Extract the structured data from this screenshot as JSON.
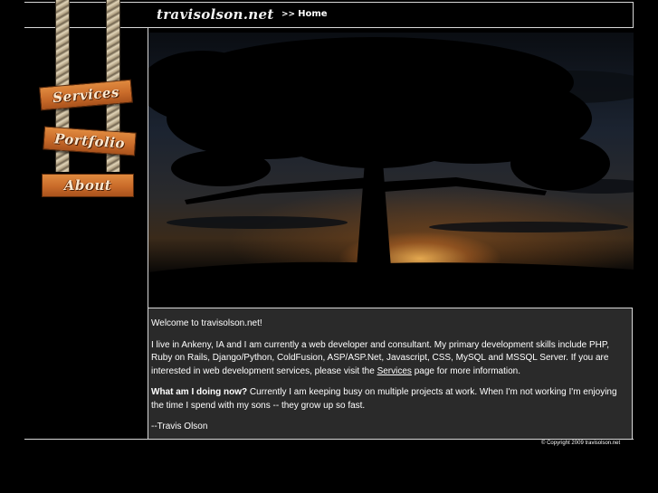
{
  "header": {
    "logo": "travisolson.net",
    "breadcrumb_sep": ">>",
    "breadcrumb_current": "Home"
  },
  "nav": {
    "items": [
      {
        "label": "Services"
      },
      {
        "label": "Portfolio"
      },
      {
        "label": "About"
      }
    ]
  },
  "content": {
    "welcome": "Welcome to travisolson.net!",
    "intro_before_link": "I live in Ankeny, IA and I am currently a web developer and consultant. My primary development skills include PHP, Ruby on Rails, Django/Python, ColdFusion, ASP/ASP.Net, Javascript, CSS, MySQL and MSSQL Server. If you are interested in web development services, please visit the ",
    "intro_link": "Services",
    "intro_after_link": " page for more information.",
    "doing_heading": "What am I doing now?",
    "doing_text": " Currently I am keeping busy on multiple projects at work. When I'm not working I'm enjoying the time I spend with my sons -- they grow up so fast.",
    "signature": "--Travis Olson"
  },
  "footer": {
    "copyright": "© Copyright 2009 travisolson.net"
  },
  "colors": {
    "background": "#000000",
    "content_bg": "#2a2a2a",
    "sign_wood": "#c96b2a",
    "rule": "#d8d8d8"
  }
}
